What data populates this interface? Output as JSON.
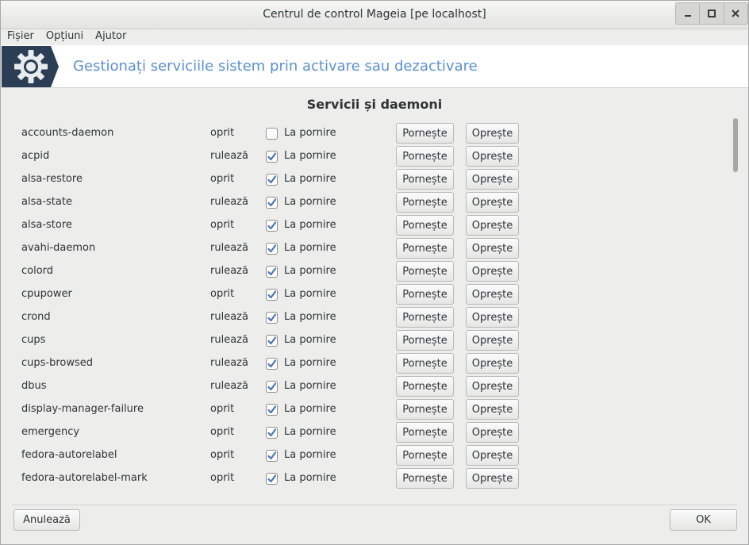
{
  "window": {
    "title": "Centrul de control Mageia  [pe localhost]"
  },
  "menu": [
    "Fișier",
    "Opțiuni",
    "Ajutor"
  ],
  "banner": {
    "icon": "gear-icon",
    "text": "Gestionați serviciile sistem prin activare sau dezactivare"
  },
  "section_title": "Servicii și daemoni",
  "checkbox_label": "La pornire",
  "start_label": "Pornește",
  "stop_label": "Oprește",
  "services": [
    {
      "name": "accounts-daemon",
      "state": "oprit",
      "on_boot": false
    },
    {
      "name": "acpid",
      "state": "rulează",
      "on_boot": true
    },
    {
      "name": "alsa-restore",
      "state": "oprit",
      "on_boot": true
    },
    {
      "name": "alsa-state",
      "state": "rulează",
      "on_boot": true
    },
    {
      "name": "alsa-store",
      "state": "oprit",
      "on_boot": true
    },
    {
      "name": "avahi-daemon",
      "state": "rulează",
      "on_boot": true
    },
    {
      "name": "colord",
      "state": "rulează",
      "on_boot": true
    },
    {
      "name": "cpupower",
      "state": "oprit",
      "on_boot": true
    },
    {
      "name": "crond",
      "state": "rulează",
      "on_boot": true
    },
    {
      "name": "cups",
      "state": "rulează",
      "on_boot": true
    },
    {
      "name": "cups-browsed",
      "state": "rulează",
      "on_boot": true
    },
    {
      "name": "dbus",
      "state": "rulează",
      "on_boot": true
    },
    {
      "name": "display-manager-failure",
      "state": "oprit",
      "on_boot": true
    },
    {
      "name": "emergency",
      "state": "oprit",
      "on_boot": true
    },
    {
      "name": "fedora-autorelabel",
      "state": "oprit",
      "on_boot": true
    },
    {
      "name": "fedora-autorelabel-mark",
      "state": "oprit",
      "on_boot": true
    }
  ],
  "footer": {
    "cancel_label": "Anulează",
    "ok_label": "OK"
  },
  "colors": {
    "accent_text": "#5a91d1",
    "check_mark": "#4a74b8",
    "logo_bg": "#2b3e55"
  }
}
